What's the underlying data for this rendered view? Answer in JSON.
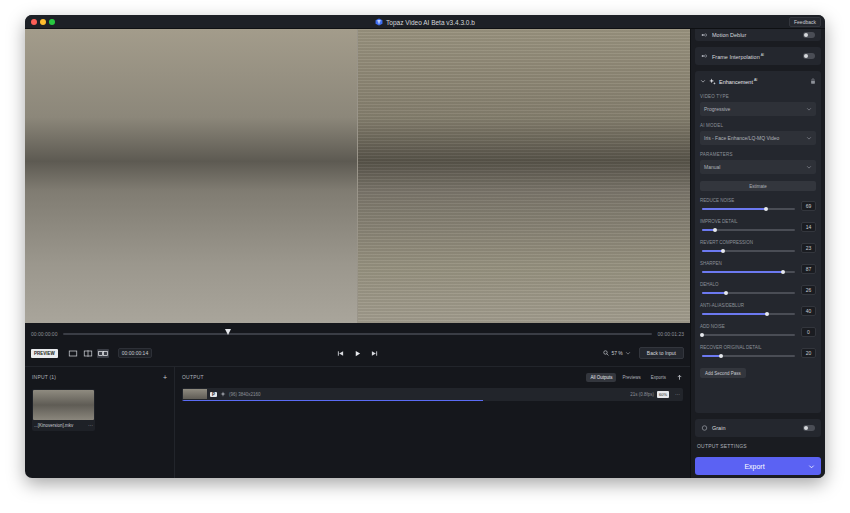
{
  "window": {
    "title": "Topaz Video AI Beta v3.4.3.0.b",
    "feedback": "Feedback"
  },
  "timeline": {
    "start": "00:00:00:00",
    "end": "00:00:01:23",
    "playhead": 0.28
  },
  "controls": {
    "preview": "PREVIEW",
    "views": [
      {
        "kind": "single",
        "selected": false
      },
      {
        "kind": "split",
        "selected": false
      },
      {
        "kind": "side",
        "selected": true
      }
    ],
    "time": "00:00:00:14",
    "zoom": "57 %",
    "back": "Back to Input"
  },
  "input": {
    "title": "INPUT (1)",
    "add": "+",
    "file": {
      "name": "...[Kinoversion].mkv",
      "menu": "⋯"
    }
  },
  "output": {
    "title": "OUTPUT",
    "tabs": [
      {
        "label": "All Outputs",
        "selected": true
      },
      {
        "label": "Previews",
        "selected": false
      },
      {
        "label": "Exports",
        "selected": false
      }
    ],
    "rows": [
      {
        "badge": "P",
        "info": "(96) 3840x2160",
        "time": "21s (0.8fps)",
        "percent": "60%",
        "menu": "⋯",
        "level": 0.6
      }
    ]
  },
  "panel": {
    "toggles": [
      {
        "label": "Motion Deblur",
        "badge": "",
        "on": false
      },
      {
        "label": "Frame Interpolation",
        "badge": "AI",
        "on": false
      }
    ],
    "enhancement": {
      "label": "Enhancement",
      "badge": "AI",
      "expanded": true,
      "fields": [
        {
          "label": "VIDEO TYPE",
          "value": "Progressive"
        },
        {
          "label": "AI MODEL",
          "value": "Iris - Face Enhance/LQ-MQ Video"
        },
        {
          "label": "PARAMETERS",
          "value": "Manual"
        }
      ],
      "estimate": "Estimate",
      "sliders": [
        {
          "label": "REDUCE NOISE",
          "value": "69",
          "level": 0.69
        },
        {
          "label": "IMPROVE DETAIL",
          "value": "14",
          "level": 0.14
        },
        {
          "label": "REVERT COMPRESSION",
          "value": "23",
          "level": 0.23
        },
        {
          "label": "SHARPEN",
          "value": "87",
          "level": 0.87
        },
        {
          "label": "DEHALO",
          "value": "26",
          "level": 0.26
        },
        {
          "label": "ANTI-ALIAS/DEBLUR",
          "value": "40",
          "level": 0.7
        },
        {
          "label": "ADD NOISE",
          "value": "0",
          "level": 0
        },
        {
          "label": "RECOVER ORIGINAL DETAIL",
          "value": "20",
          "level": 0.2
        }
      ],
      "second_pass": "Add Second Pass"
    },
    "grain": {
      "label": "Grain",
      "on": false
    },
    "output_settings": "OUTPUT SETTINGS",
    "export": "Export"
  }
}
